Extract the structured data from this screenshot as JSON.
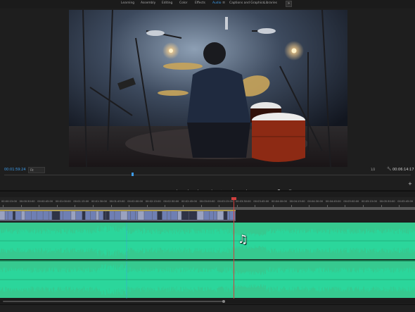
{
  "workspaces": {
    "tabs": [
      {
        "label": "Learning"
      },
      {
        "label": "Assembly"
      },
      {
        "label": "Editing"
      },
      {
        "label": "Color"
      },
      {
        "label": "Effects"
      },
      {
        "label": "Audio",
        "active": true
      },
      {
        "label": "Captions and Graphics"
      },
      {
        "label": "Libraries"
      }
    ],
    "menu_glyph": "≡",
    "expand_glyph": "»"
  },
  "program_monitor": {
    "current_timecode": "00:01:59:24",
    "zoom": "Fit",
    "resolution": "1/2",
    "duration": "00:06:14:17",
    "transport": [
      "▾",
      "|",
      "|",
      "|←",
      "◂|",
      "▶",
      "|▸",
      "→|",
      "⊏",
      "⊐",
      "◘",
      "⊞"
    ],
    "add_button": "+"
  },
  "timeline": {
    "ruler_labels": [
      "00:00:15:00",
      "00:00:30:00",
      "00:00:45:00",
      "00:01:00:00",
      "00:01:15:00",
      "00:01:30:00",
      "00:01:45:00",
      "00:02:00:00",
      "00:02:15:00",
      "00:02:30:00",
      "00:02:45:00",
      "00:03:00:00",
      "00:03:15:00",
      "00:03:30:00",
      "00:03:45:00",
      "00:04:00:00",
      "00:04:15:00",
      "00:04:30:00",
      "00:04:45:00",
      "00:05:00:00",
      "00:05:15:00",
      "00:05:30:00",
      "00:05:45:00"
    ],
    "playhead_position": "00:01:59:24",
    "scroll_handle_glyph": "○"
  },
  "colors": {
    "accent": "#3d9be9",
    "audio_waveform": "#2bd69b",
    "audio_clip_body": "#36c98f",
    "playhead": "#d0403f",
    "video_clip": "#6f7fb4"
  }
}
